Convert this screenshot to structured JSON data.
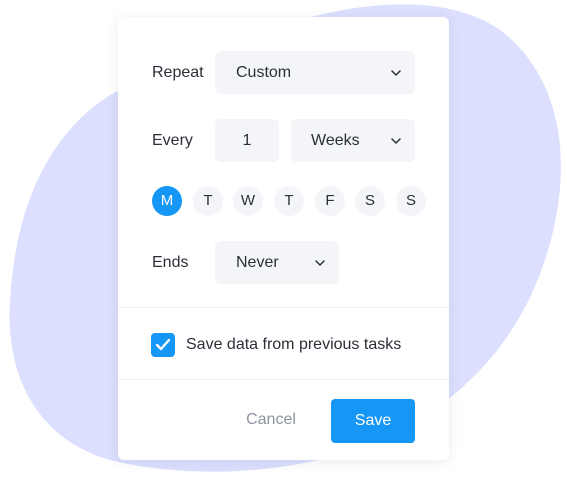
{
  "colors": {
    "accent": "#1696f5",
    "blob": "#dcdffd",
    "field_bg": "#f3f5f8"
  },
  "repeat": {
    "label": "Repeat",
    "selected": "Custom",
    "icon": "chevron-down-icon"
  },
  "every": {
    "label": "Every",
    "count": "1",
    "unit": "Weeks",
    "icon": "chevron-down-icon"
  },
  "days": [
    {
      "label": "M",
      "selected": true
    },
    {
      "label": "T",
      "selected": false
    },
    {
      "label": "W",
      "selected": false
    },
    {
      "label": "T",
      "selected": false
    },
    {
      "label": "F",
      "selected": false
    },
    {
      "label": "S",
      "selected": false
    },
    {
      "label": "S",
      "selected": false
    }
  ],
  "ends": {
    "label": "Ends",
    "selected": "Never",
    "icon": "chevron-down-icon"
  },
  "save_previous": {
    "checked": true,
    "label": "Save data from previous tasks"
  },
  "actions": {
    "cancel_label": "Cancel",
    "save_label": "Save"
  }
}
